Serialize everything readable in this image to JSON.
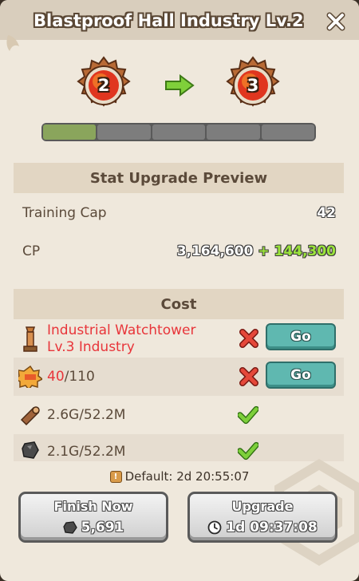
{
  "header": {
    "title": "Blastproof Hall Industry Lv.2"
  },
  "upgrade": {
    "current_level": "2",
    "next_level": "3",
    "progress_segments_total": 5,
    "progress_segments_filled": 1
  },
  "stats": {
    "section_title": "Stat Upgrade Preview",
    "rows": [
      {
        "label": "Training Cap",
        "value": "42",
        "bonus": ""
      },
      {
        "label": "CP",
        "value": "3,164,600",
        "bonus": "+ 144,300"
      }
    ]
  },
  "cost": {
    "section_title": "Cost",
    "requirement": {
      "name_line1": "Industrial Watchtower",
      "name_line2": "Lv.3 Industry",
      "met": false,
      "go_label": "Go"
    },
    "badge": {
      "have": "40",
      "need": "/110",
      "met": false,
      "go_label": "Go"
    },
    "wood": {
      "text": "2.6G/52.2M",
      "met": true
    },
    "ore": {
      "text": "2.1G/52.2M",
      "met": true
    }
  },
  "default_time": {
    "text": "Default: 2d 20:55:07"
  },
  "buttons": {
    "finish_now": {
      "label": "Finish Now",
      "cost": "5,691"
    },
    "upgrade": {
      "label": "Upgrade",
      "time": "1d 09:37:08"
    }
  },
  "colors": {
    "accent_green": "#9be43b",
    "unmet_red": "#e8353a",
    "go_teal": "#5fb8b0",
    "progress_fill": "#8aa55c"
  }
}
